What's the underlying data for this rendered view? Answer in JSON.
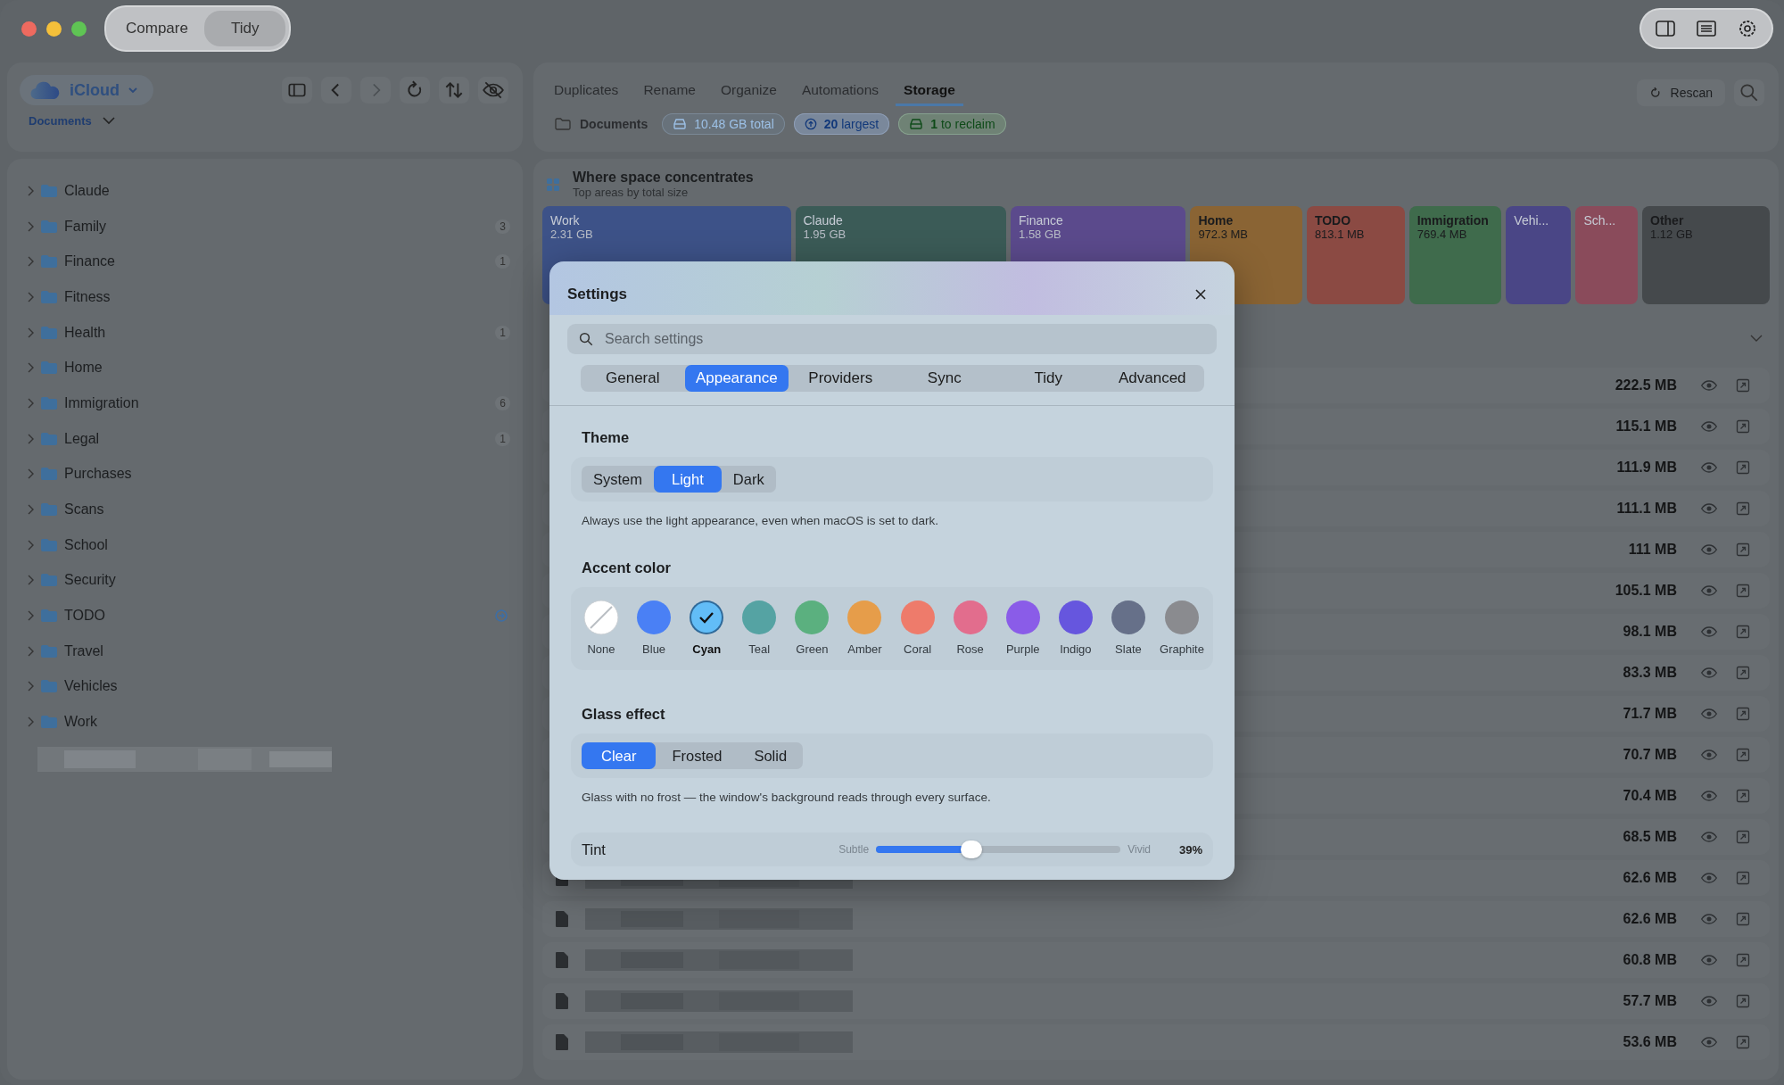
{
  "window": {
    "modes": [
      {
        "label": "Compare",
        "selected": false
      },
      {
        "label": "Tidy",
        "selected": true
      }
    ]
  },
  "sidebar": {
    "source": "iCloud",
    "location": "Documents",
    "items": [
      {
        "name": "Claude",
        "expanded": false,
        "pending": false
      },
      {
        "name": "Family",
        "expanded": false,
        "badge": "3",
        "pending": false
      },
      {
        "name": "Finance",
        "expanded": false,
        "badge": "1",
        "pending": false
      },
      {
        "name": "Fitness",
        "expanded": false,
        "pending": false
      },
      {
        "name": "Health",
        "expanded": false,
        "badge": "1",
        "pending": false
      },
      {
        "name": "Home",
        "expanded": false,
        "pending": false
      },
      {
        "name": "Immigration",
        "expanded": false,
        "badge": "6",
        "pending": false
      },
      {
        "name": "Legal",
        "expanded": false,
        "badge": "1",
        "pending": false
      },
      {
        "name": "Purchases",
        "expanded": false,
        "pending": false
      },
      {
        "name": "Scans",
        "expanded": false,
        "pending": false
      },
      {
        "name": "School",
        "expanded": false,
        "pending": false
      },
      {
        "name": "Security",
        "expanded": false,
        "pending": false
      },
      {
        "name": "TODO",
        "expanded": false,
        "pending": true
      },
      {
        "name": "Travel",
        "expanded": false,
        "pending": false
      },
      {
        "name": "Vehicles",
        "expanded": false,
        "pending": false
      },
      {
        "name": "Work",
        "expanded": false,
        "pending": false
      }
    ]
  },
  "tabs": [
    {
      "label": "Duplicates",
      "selected": false
    },
    {
      "label": "Rename",
      "selected": false
    },
    {
      "label": "Organize",
      "selected": false
    },
    {
      "label": "Automations",
      "selected": false
    },
    {
      "label": "Storage",
      "selected": true
    }
  ],
  "rescan": "Rescan",
  "path": "Documents",
  "chips": [
    {
      "kind": "total",
      "text": "10.48 GB total"
    },
    {
      "kind": "largest",
      "text": "**20** largest"
    },
    {
      "kind": "reclaim",
      "text": "**1** to reclaim"
    }
  ],
  "treemap": {
    "title": "Where space concentrates",
    "subtitle": "Top areas by total size",
    "tiles": [
      {
        "name": "Work",
        "size": "2.31 GB",
        "color": "#3d5288"
      },
      {
        "name": "Claude",
        "size": "1.95 GB",
        "color": "#3b5b57"
      },
      {
        "name": "Finance",
        "size": "1.58 GB",
        "color": "#5b4a8c"
      },
      {
        "name": "Home",
        "size": "972.3 MB",
        "color": "#8a6434"
      },
      {
        "name": "TODO",
        "size": "813.1 MB",
        "color": "#8b4a43"
      },
      {
        "name": "Immigration",
        "size": "769.4 MB",
        "color": "#3f6b4c"
      },
      {
        "name": "Vehi...",
        "color": "#4a4686"
      },
      {
        "name": "Sch...",
        "color": "#8a4b5b"
      },
      {
        "name": "Other",
        "size": "1.12 GB",
        "color": "#45494c"
      }
    ]
  },
  "files": [
    {
      "size": "222.5 MB"
    },
    {
      "size": "115.1 MB"
    },
    {
      "size": "111.9 MB"
    },
    {
      "size": "111.1 MB"
    },
    {
      "size": "111 MB"
    },
    {
      "size": "105.1 MB"
    },
    {
      "size": "98.1 MB"
    },
    {
      "size": "83.3 MB"
    },
    {
      "size": "71.7 MB"
    },
    {
      "size": "70.7 MB"
    },
    {
      "size": "70.4 MB"
    },
    {
      "size": "68.5 MB"
    },
    {
      "size": "62.6 MB"
    },
    {
      "size": "62.6 MB"
    },
    {
      "size": "60.8 MB"
    },
    {
      "size": "57.7 MB"
    },
    {
      "size": "53.6 MB"
    }
  ],
  "settings": {
    "title": "Settings",
    "search": {
      "placeholder": "Search settings"
    },
    "tabs": [
      {
        "label": "General",
        "selected": false
      },
      {
        "label": "Appearance",
        "selected": true
      },
      {
        "label": "Providers",
        "selected": false
      },
      {
        "label": "Sync",
        "selected": false
      },
      {
        "label": "Tidy",
        "selected": false
      },
      {
        "label": "Advanced",
        "selected": false
      }
    ],
    "theme": {
      "heading": "Theme",
      "options": [
        {
          "label": "System",
          "selected": false
        },
        {
          "label": "Light",
          "selected": true
        },
        {
          "label": "Dark",
          "selected": false
        }
      ],
      "description": "Always use the light appearance, even when macOS is set to dark."
    },
    "accent": {
      "heading": "Accent color",
      "swatches": [
        {
          "kind": "none",
          "label": "None",
          "selected": false
        },
        {
          "kind": "color",
          "label": "Blue",
          "color": "#4a80f5",
          "selected": false
        },
        {
          "kind": "color",
          "label": "Cyan",
          "color": "#62bdf7",
          "selected": true
        },
        {
          "kind": "color",
          "label": "Teal",
          "color": "#55a3a3",
          "selected": false
        },
        {
          "kind": "color",
          "label": "Green",
          "color": "#5bb07f",
          "selected": false
        },
        {
          "kind": "color",
          "label": "Amber",
          "color": "#e69d4a",
          "selected": false
        },
        {
          "kind": "color",
          "label": "Coral",
          "color": "#ee7b6b",
          "selected": false
        },
        {
          "kind": "color",
          "label": "Rose",
          "color": "#e26d8d",
          "selected": false
        },
        {
          "kind": "color",
          "label": "Purple",
          "color": "#8a5ce8",
          "selected": false
        },
        {
          "kind": "color",
          "label": "Indigo",
          "color": "#6656de",
          "selected": false
        },
        {
          "kind": "color",
          "label": "Slate",
          "color": "#667089",
          "selected": false
        },
        {
          "kind": "color",
          "label": "Graphite",
          "color": "#8a8b8f",
          "selected": false
        }
      ]
    },
    "glass": {
      "heading": "Glass effect",
      "options": [
        {
          "label": "Clear",
          "selected": true
        },
        {
          "label": "Frosted",
          "selected": false
        },
        {
          "label": "Solid",
          "selected": false
        }
      ],
      "description": "Glass with no frost — the window's background reads through every surface."
    },
    "tint": {
      "label": "Tint",
      "min_label": "Subtle",
      "max_label": "Vivid",
      "level": 0.39,
      "reading": "39%"
    }
  }
}
